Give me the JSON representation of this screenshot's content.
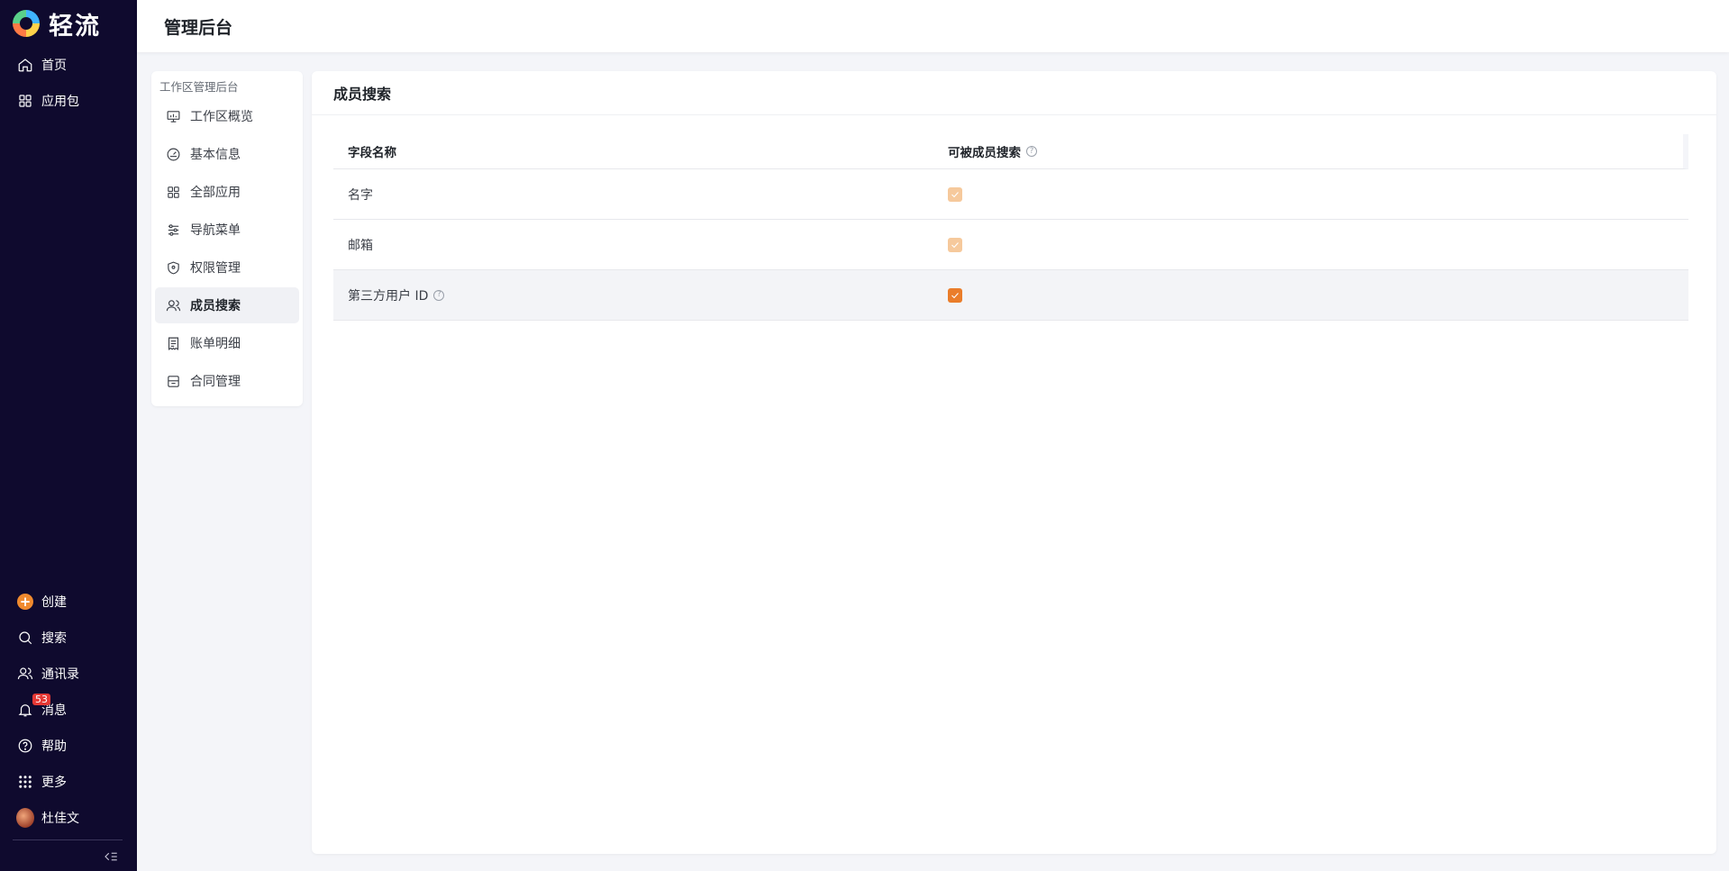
{
  "brand": {
    "name": "轻流"
  },
  "sidebar": {
    "top_items": [
      {
        "label": "首页",
        "icon": "home-icon"
      },
      {
        "label": "应用包",
        "icon": "grid-icon"
      }
    ],
    "bottom_items": [
      {
        "label": "创建",
        "icon": "plus-circle-icon"
      },
      {
        "label": "搜索",
        "icon": "search-icon"
      },
      {
        "label": "通讯录",
        "icon": "contacts-icon"
      },
      {
        "label": "消息",
        "icon": "bell-icon",
        "badge": "53"
      },
      {
        "label": "帮助",
        "icon": "help-circle-icon"
      },
      {
        "label": "更多",
        "icon": "dots-grid-icon"
      },
      {
        "label": "杜佳文",
        "icon": "avatar"
      }
    ]
  },
  "header": {
    "title": "管理后台"
  },
  "submenu": {
    "title": "工作区管理后台",
    "items": [
      {
        "label": "工作区概览",
        "icon": "monitor-chart-icon"
      },
      {
        "label": "基本信息",
        "icon": "dashboard-icon"
      },
      {
        "label": "全部应用",
        "icon": "apps-icon"
      },
      {
        "label": "导航菜单",
        "icon": "sliders-icon"
      },
      {
        "label": "权限管理",
        "icon": "shield-icon"
      },
      {
        "label": "成员搜索",
        "icon": "users-icon",
        "active": true
      },
      {
        "label": "账单明细",
        "icon": "receipt-icon"
      },
      {
        "label": "合同管理",
        "icon": "contract-icon"
      }
    ]
  },
  "main": {
    "title": "成员搜索",
    "table": {
      "headers": {
        "field": "字段名称",
        "searchable": "可被成员搜索"
      },
      "rows": [
        {
          "name": "名字",
          "checked": true,
          "disabled": true
        },
        {
          "name": "邮箱",
          "checked": true,
          "disabled": true
        },
        {
          "name": "第三方用户 ID",
          "checked": true,
          "disabled": false,
          "has_help": true
        }
      ]
    }
  },
  "colors": {
    "sidebar_bg": "#0f0a2e",
    "accent": "#ea7d2a",
    "accent_disabled": "#f6c99c",
    "badge": "#e53935"
  }
}
